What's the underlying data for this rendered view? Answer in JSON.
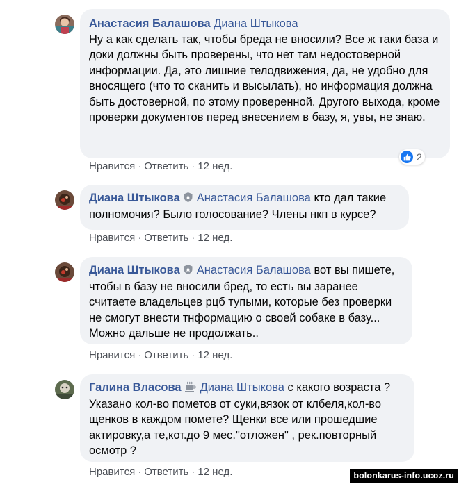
{
  "comments": [
    {
      "author": "Анастасия Балашова",
      "mention": "Диана Штыкова",
      "text_first": "Ну а как сделать так, чтобы бреда не вносили? Все ж таки база и доки должны быть проверены, что нет там недостоверной информации. Да, это лишние телодвижения, да, не удобно для вносящего (что то сканить и высылать), но информация должна быть достоверной, по этому проверенной. Другого выхода, кроме проверки документов перед внесением в базу, я, увы, не знаю.",
      "like": "Нравится",
      "reply": "Ответить",
      "time": "12 нед.",
      "reaction_count": "2"
    },
    {
      "author": "Диана Штыкова",
      "mention": "Анастасия Балашова",
      "text": "кто дал такие полномочия? Было голосование? Члены нкп в курсе?",
      "like": "Нравится",
      "reply": "Ответить",
      "time": "12 нед."
    },
    {
      "author": "Диана Штыкова",
      "mention": "Анастасия Балашова",
      "text": "вот вы пишете, чтобы в базу не вносили бред, то есть вы заранее считаете владельцев рцб тупыми, которые без проверки не смогут внести тнформацию о своей собаке в базу... Можно дальше не продолжать..",
      "like": "Нравится",
      "reply": "Ответить",
      "time": "12 нед."
    },
    {
      "author": "Галина Власова",
      "mention": "Диана Штыкова",
      "text": "с какого возраста ? Указано кол-во пометов от суки,вязок от клбеля,кол-во щенков в каждом помете? Щенки все или прошедшие актировку,а те,кот.до 9 мес.\"отложен\" , рек.повторный осмотр ?",
      "like": "Нравится",
      "reply": "Ответить",
      "time": "12 нед."
    }
  ],
  "watermark": "bolonkarus-info.ucoz.ru",
  "colors": {
    "author": "#385898",
    "bubble": "#f0f2f5",
    "like_blue": "#1877f2"
  },
  "icons": [
    "top-fan-badge-icon",
    "coffee-badge-icon",
    "like-reaction-icon"
  ]
}
